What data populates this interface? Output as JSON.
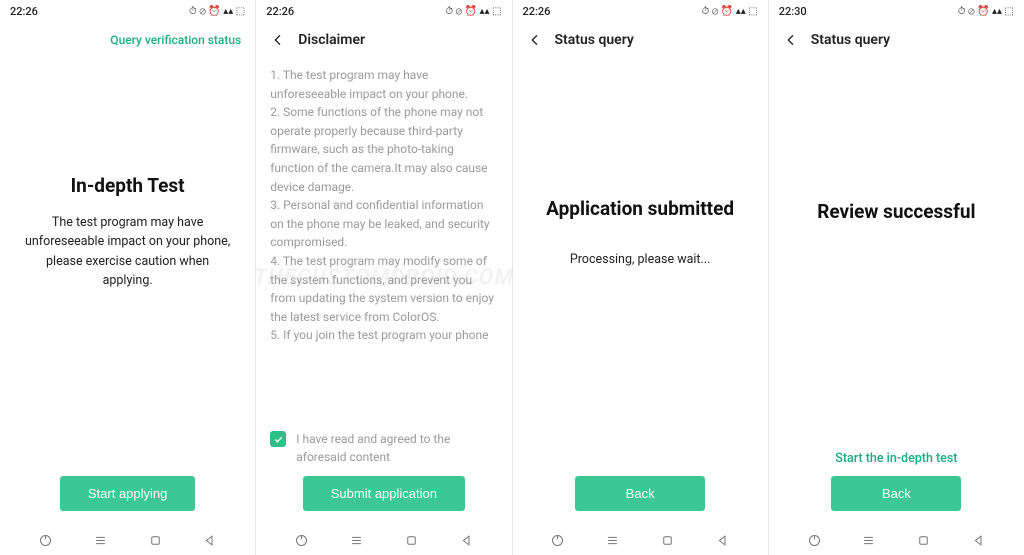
{
  "watermark": "THECUSTOMDROID.COM",
  "status_icons": "⏱ ⊘ ⏰ ▴▴ ⬚",
  "screens": [
    {
      "time": "22:26",
      "top_link": "Query verification status",
      "title": "In-depth Test",
      "desc": "The test program may have unforeseeable impact on your phone, please exercise caution when applying.",
      "button": "Start applying"
    },
    {
      "time": "22:26",
      "header": "Disclaimer",
      "body": "1. The test program may have unforeseeable impact on your phone.\n2. Some functions of the phone may not operate properly because third-party firmware, such as the photo-taking function of the camera.It may also cause device damage.\n3. Personal and confidential information on the phone may be leaked, and security compromised.\n4. The test program may modify some of the system functions, and prevent you from updating the system version to enjoy the latest service from ColorOS.\n5. If you join the test program your phone",
      "agree": "I have read and agreed to the aforesaid content",
      "checked": true,
      "button": "Submit application"
    },
    {
      "time": "22:26",
      "header": "Status query",
      "title": "Application submitted",
      "sub": "Processing, please wait...",
      "button": "Back"
    },
    {
      "time": "22:30",
      "header": "Status query",
      "title": "Review successful",
      "bottom_link": "Start the in-depth test",
      "button": "Back"
    }
  ]
}
